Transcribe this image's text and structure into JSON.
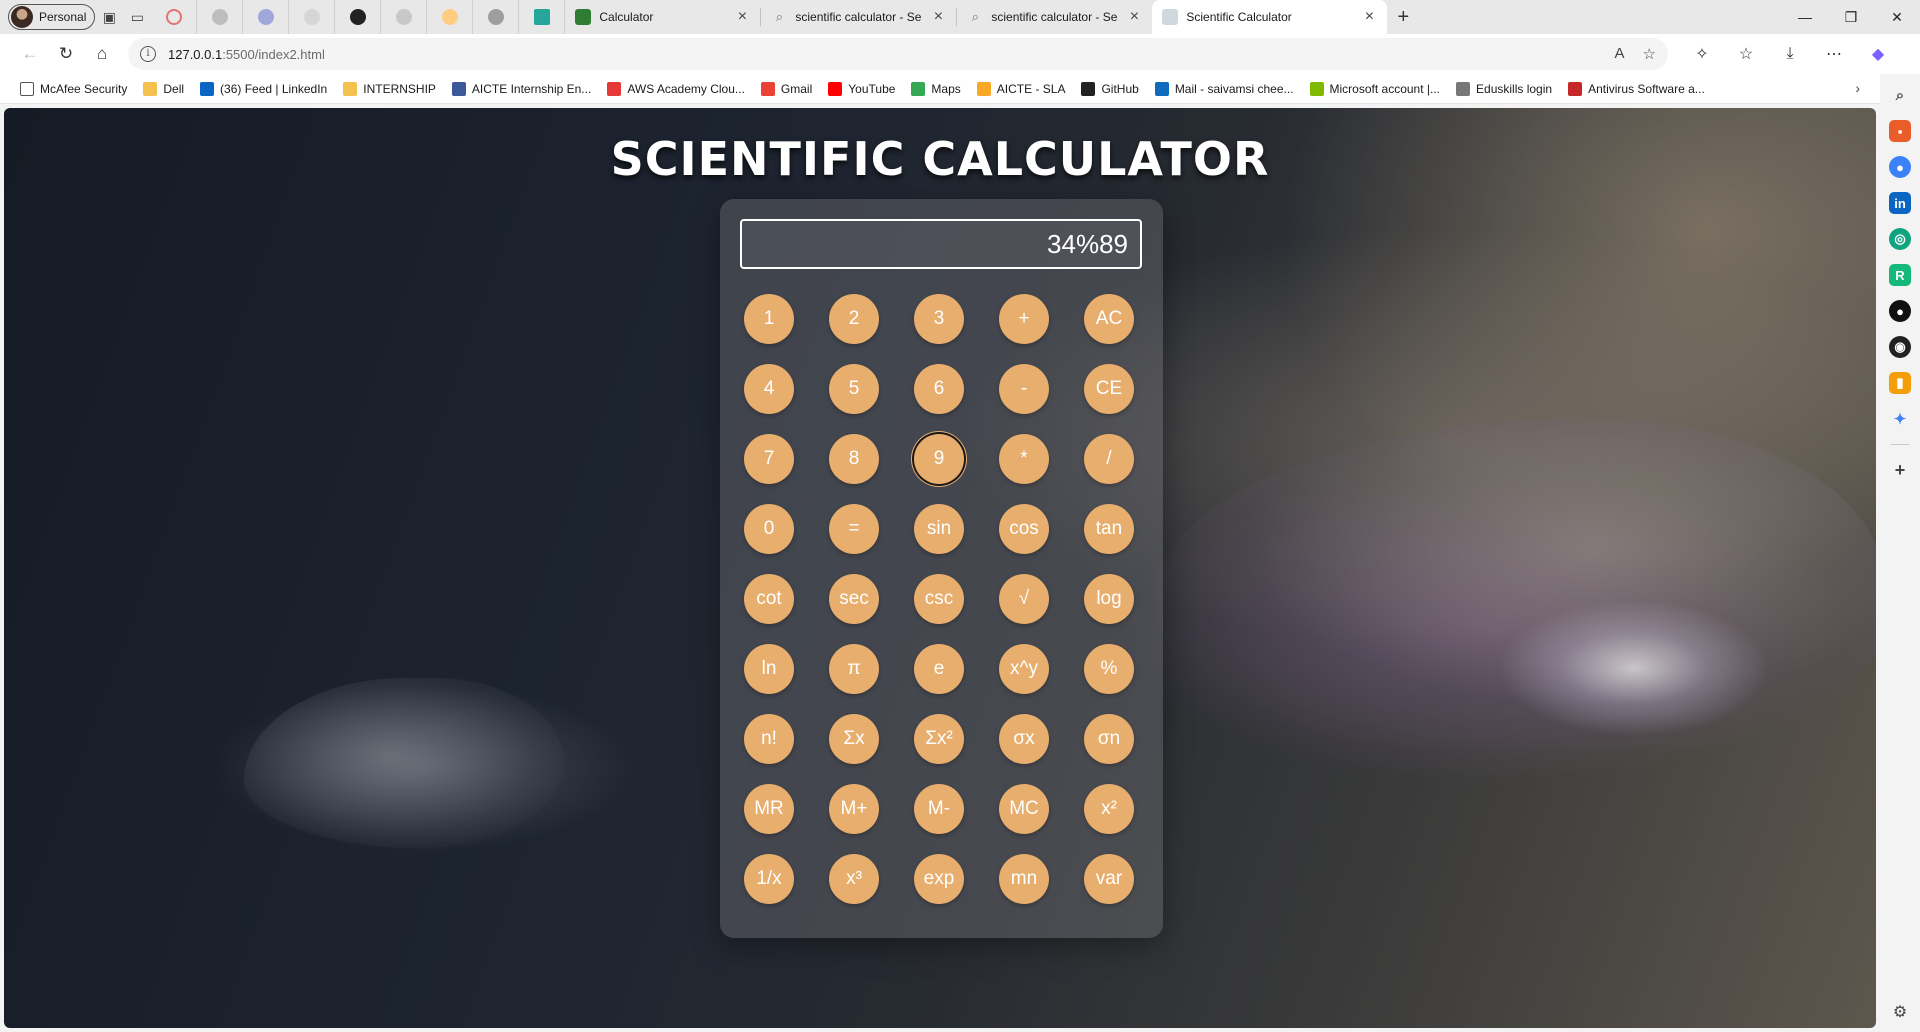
{
  "profile": {
    "label": "Personal"
  },
  "tabs": [
    {
      "title": "Calculator",
      "active": false,
      "fav_color": "#2e7d32"
    },
    {
      "title": "scientific calculator - Search",
      "active": false,
      "fav_color": "#9e9e9e"
    },
    {
      "title": "scientific calculator - Search Imag",
      "active": false,
      "fav_color": "#9e9e9e"
    },
    {
      "title": "Scientific Calculator",
      "active": true,
      "fav_color": "#cfd8dc"
    }
  ],
  "address": {
    "host": "127.0.0.1",
    "rest": ":5500/index2.html"
  },
  "favorites": [
    {
      "label": "McAfee Security",
      "color": "#ffffff"
    },
    {
      "label": "Dell",
      "color": "#f2c14e"
    },
    {
      "label": "(36) Feed | LinkedIn",
      "color": "#0a66c2"
    },
    {
      "label": "INTERNSHIP",
      "color": "#f2c14e"
    },
    {
      "label": "AICTE Internship En...",
      "color": "#3b5998"
    },
    {
      "label": "AWS Academy Clou...",
      "color": "#e53935"
    },
    {
      "label": "Gmail",
      "color": "#ea4335"
    },
    {
      "label": "YouTube",
      "color": "#ff0000"
    },
    {
      "label": "Maps",
      "color": "#34a853"
    },
    {
      "label": "AICTE - SLA",
      "color": "#f9a825"
    },
    {
      "label": "GitHub",
      "color": "#222222"
    },
    {
      "label": "Mail - saivamsi chee...",
      "color": "#0f6cbd"
    },
    {
      "label": "Microsoft account |...",
      "color": "#7fba00"
    },
    {
      "label": "Eduskills login",
      "color": "#777777"
    },
    {
      "label": "Antivirus Software a...",
      "color": "#c62828"
    }
  ],
  "page": {
    "title": "SCIENTIFIC CALCULATOR",
    "display_value": "34%89"
  },
  "keys": [
    [
      "1",
      "2",
      "3",
      "+",
      "AC"
    ],
    [
      "4",
      "5",
      "6",
      "-",
      "CE"
    ],
    [
      "7",
      "8",
      "9",
      "*",
      "/"
    ],
    [
      "0",
      "=",
      "sin",
      "cos",
      "tan"
    ],
    [
      "cot",
      "sec",
      "csc",
      "√",
      "log"
    ],
    [
      "ln",
      "π",
      "e",
      "x^y",
      "%"
    ],
    [
      "n!",
      "Σx",
      "Σx²",
      "σx",
      "σn"
    ],
    [
      "MR",
      "M+",
      "M-",
      "MC",
      "x²"
    ],
    [
      "1/x",
      "x³",
      "exp",
      "mn",
      "var"
    ]
  ],
  "focused_key": "9",
  "colors": {
    "key_bg": "#e8ae6e",
    "display_border": "#ffffff"
  }
}
